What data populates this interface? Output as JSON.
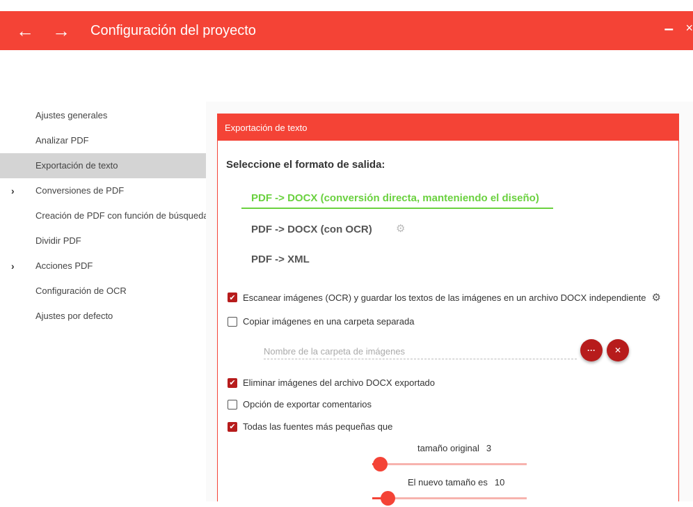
{
  "window": {
    "title": "Configuración del proyecto",
    "back_icon": "←",
    "forward_icon": "→",
    "minimize_icon": "–",
    "close_icon": "×"
  },
  "sidebar": {
    "items": [
      {
        "label": "Ajustes generales",
        "expandable": false,
        "active": false
      },
      {
        "label": "Analizar PDF",
        "expandable": false,
        "active": false
      },
      {
        "label": "Exportación de texto",
        "expandable": false,
        "active": true
      },
      {
        "label": "Conversiones de PDF",
        "expandable": true,
        "active": false
      },
      {
        "label": "Creación de PDF con función de búsqueda",
        "expandable": false,
        "active": false
      },
      {
        "label": "Dividir PDF",
        "expandable": false,
        "active": false
      },
      {
        "label": "Acciones PDF",
        "expandable": true,
        "active": false
      },
      {
        "label": "Configuración de OCR",
        "expandable": false,
        "active": false
      },
      {
        "label": "Ajustes por defecto",
        "expandable": false,
        "active": false
      }
    ],
    "chevron_icon": "›"
  },
  "panel": {
    "header": "Exportación de texto",
    "section_title": "Seleccione el formato de salida:",
    "formats": [
      {
        "label": "PDF -> DOCX (conversión directa, manteniendo el diseño)",
        "selected": true
      },
      {
        "label": "PDF -> DOCX (con OCR)",
        "selected": false
      },
      {
        "label": "PDF -> XML",
        "selected": false
      }
    ],
    "gear_icon": "⚙",
    "options": {
      "scan_images": {
        "label": "Escanear imágenes (OCR) y guardar los textos de las imágenes en un archivo DOCX independiente",
        "checked": true
      },
      "copy_images": {
        "label": "Copiar imágenes en una carpeta separada",
        "checked": false
      },
      "remove_images": {
        "label": "Eliminar imágenes del archivo DOCX exportado",
        "checked": true
      },
      "export_comments": {
        "label": "Opción de exportar comentarios",
        "checked": false
      },
      "smaller_fonts": {
        "label": "Todas las fuentes más pequeñas que",
        "checked": true
      }
    },
    "checkmark": "✔",
    "folder": {
      "placeholder": "Nombre de la carpeta de imágenes",
      "browse_label": "···",
      "clear_label": "✕"
    },
    "sliders": {
      "original_size": {
        "label": "tamaño original",
        "value": "3",
        "level": 0.05
      },
      "new_size": {
        "label": "El nuevo tamaño es",
        "value": "10",
        "level": 0.1
      }
    }
  },
  "colors": {
    "accent": "#f44336",
    "dark_accent": "#b71c1c",
    "selected_green": "#6ad13f",
    "sidebar_active": "#d4d4d4"
  }
}
